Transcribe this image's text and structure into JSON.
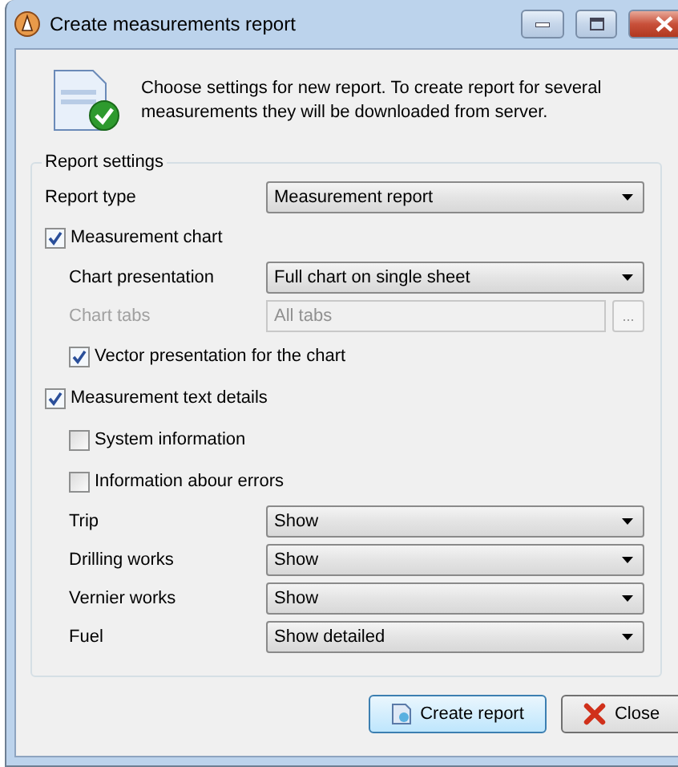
{
  "window": {
    "title": "Create measurements report"
  },
  "intro": "Choose settings for new report. To create report for several measurements they will be downloaded from server.",
  "group": {
    "title": "Report settings",
    "rows": [
      {
        "kind": "select",
        "label": "Report type",
        "value": "Measurement report"
      },
      {
        "kind": "checkbox",
        "label": "Measurement chart",
        "checked": true,
        "children": [
          {
            "kind": "select",
            "label": "Chart presentation",
            "value": "Full chart on single sheet"
          },
          {
            "kind": "field",
            "label": "Chart tabs",
            "value": "All tabs",
            "disabled": true,
            "button": "..."
          },
          {
            "kind": "checkbox",
            "label": "Vector presentation for the chart",
            "checked": true
          }
        ]
      },
      {
        "kind": "checkbox",
        "label": "Measurement text details",
        "checked": true,
        "children": [
          {
            "kind": "checkbox",
            "label": "System information",
            "checked": false
          },
          {
            "kind": "checkbox",
            "label": "Information abour errors",
            "checked": false
          },
          {
            "kind": "select",
            "label": "Trip",
            "value": "Show"
          },
          {
            "kind": "select",
            "label": "Drilling works",
            "value": "Show"
          },
          {
            "kind": "select",
            "label": "Vernier works",
            "value": "Show"
          },
          {
            "kind": "select",
            "label": "Fuel",
            "value": "Show detailed"
          }
        ]
      }
    ]
  },
  "buttons": [
    {
      "kind": "create",
      "label": "Create report"
    },
    {
      "kind": "close",
      "label": "Close"
    }
  ]
}
